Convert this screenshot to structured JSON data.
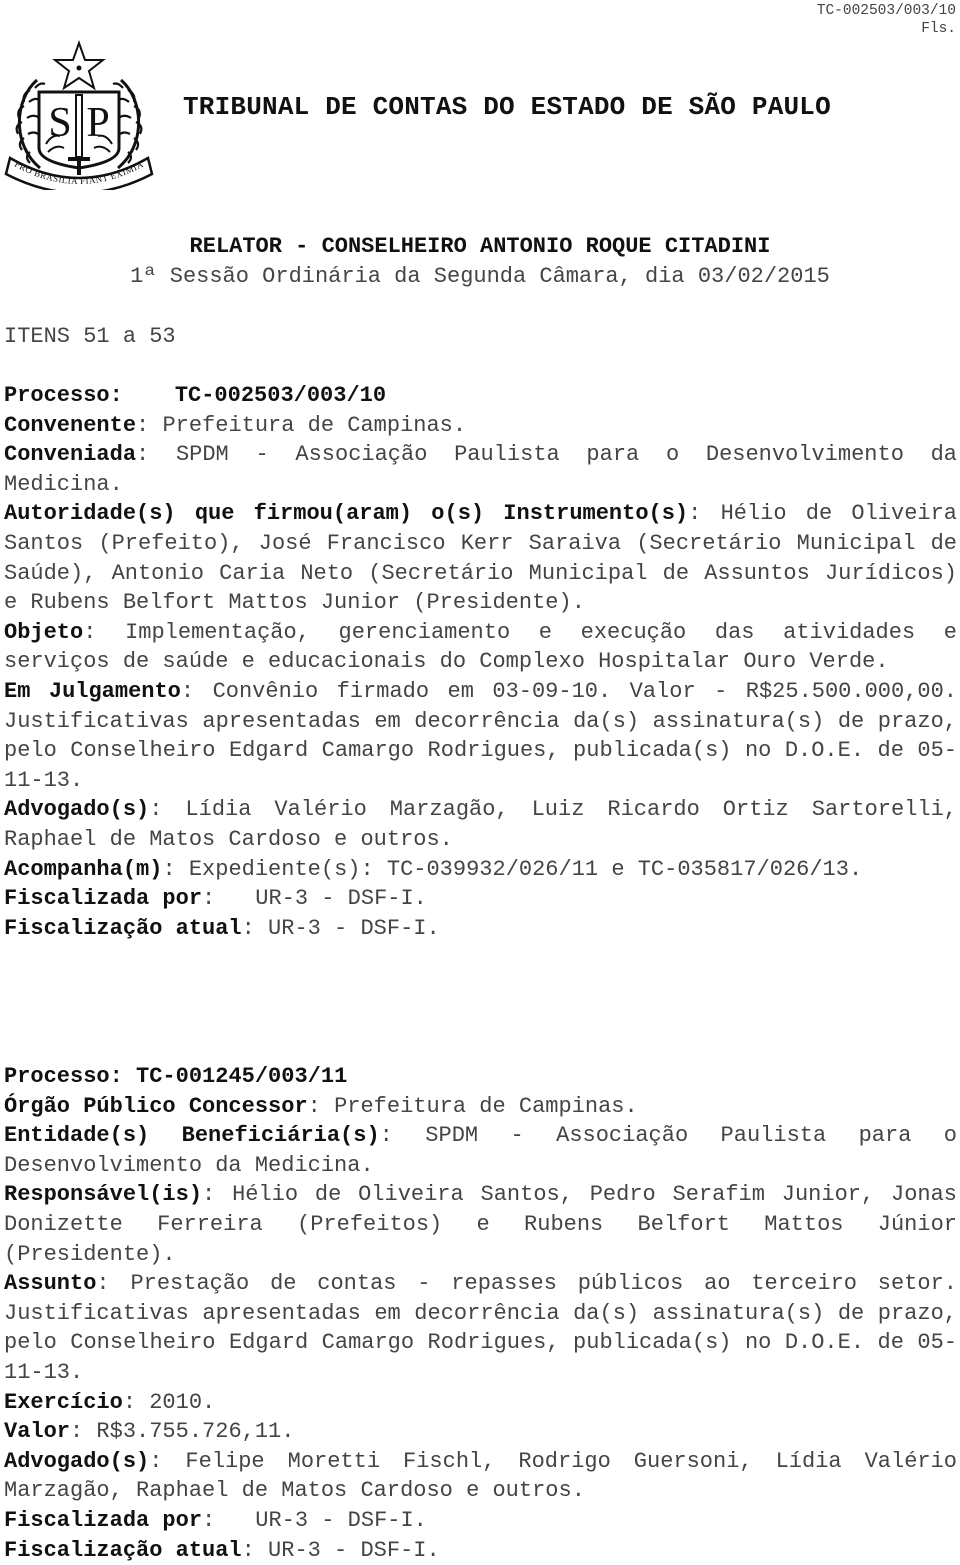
{
  "header": {
    "ref": "TC-002503/003/10",
    "fls": "Fls.",
    "title": "TRIBUNAL DE CONTAS DO ESTADO DE SÃO PAULO",
    "relator": "RELATOR - CONSELHEIRO ANTONIO ROQUE CITADINI",
    "sessao": "1ª Sessão Ordinária da Segunda Câmara, dia 03/02/2015",
    "itens": "ITENS 51 a 53",
    "logo": {
      "icon": "sao-paulo-coat-of-arms-icon",
      "letters_left": "S",
      "letters_right": "P",
      "motto": "PRO BRASILIA FIANT EXIMIA"
    }
  },
  "process1": {
    "processo_label": "Processo:",
    "processo_value": "TC-002503/003/10",
    "convenente_label": "Convenente",
    "convenente_value": "Prefeitura de Campinas.",
    "conveniada_label": "Conveniada",
    "conveniada_value": "SPDM - Associação Paulista para o Desenvolvimento da Medicina.",
    "autoridades_label": "Autoridade(s) que firmou(aram) o(s) Instrumento(s)",
    "autoridades_value": "Hélio de Oliveira Santos (Prefeito), José Francisco Kerr Saraiva (Secretário Municipal de Saúde), Antonio Caria Neto (Secretário Municipal de Assuntos Jurídicos) e Rubens Belfort Mattos Junior (Presidente).",
    "objeto_label": "Objeto",
    "objeto_value": "Implementação, gerenciamento e execução das atividades e serviços de saúde e educacionais do Complexo Hospitalar Ouro Verde.",
    "julgamento_label": "Em Julgamento",
    "julgamento_value": "Convênio firmado em 03-09-10. Valor - R$25.500.000,00. Justificativas apresentadas em decorrência da(s) assinatura(s) de prazo, pelo Conselheiro Edgard Camargo Rodrigues, publicada(s) no D.O.E. de 05-11-13.",
    "advogados_label": "Advogado(s)",
    "advogados_value": "Lídia Valério Marzagão, Luiz Ricardo Ortiz Sartorelli, Raphael de Matos Cardoso e outros.",
    "acompanha_label": "Acompanha(m)",
    "acompanha_value": "Expediente(s): TC-039932/026/11 e TC-035817/026/13.",
    "fiscalizada_label": "Fiscalizada por",
    "fiscalizada_value": "UR-3 - DSF-I.",
    "fiscalizacao_label": "Fiscalização atual",
    "fiscalizacao_value": "UR-3 - DSF-I."
  },
  "process2": {
    "processo_label": "Processo:",
    "processo_value": "TC-001245/003/11",
    "orgao_label": "Órgão Público Concessor",
    "orgao_value": "Prefeitura de Campinas.",
    "entidade_label": "Entidade(s) Beneficiária(s)",
    "entidade_value": "SPDM - Associação Paulista para o Desenvolvimento da Medicina.",
    "responsaveis_label": "Responsável(is)",
    "responsaveis_value": "Hélio de Oliveira Santos, Pedro Serafim Junior, Jonas Donizette Ferreira (Prefeitos) e Rubens Belfort Mattos Júnior (Presidente).",
    "assunto_label": "Assunto",
    "assunto_value": "Prestação de contas - repasses públicos ao terceiro setor. Justificativas apresentadas em decorrência da(s) assinatura(s) de prazo, pelo Conselheiro Edgard Camargo Rodrigues, publicada(s) no D.O.E. de 05-11-13.",
    "exercicio_label": "Exercício",
    "exercicio_value": "2010.",
    "valor_label": "Valor",
    "valor_value": "R$3.755.726,11.",
    "advogados_label": "Advogado(s)",
    "advogados_value": "Felipe Moretti Fischl, Rodrigo Guersoni, Lídia Valério Marzagão, Raphael de Matos Cardoso e outros.",
    "fiscalizada_label": "Fiscalizada por",
    "fiscalizada_value": "UR-3 - DSF-I.",
    "fiscalizacao_label": "Fiscalização atual",
    "fiscalizacao_value": "UR-3 - DSF-I."
  },
  "separator": ":"
}
